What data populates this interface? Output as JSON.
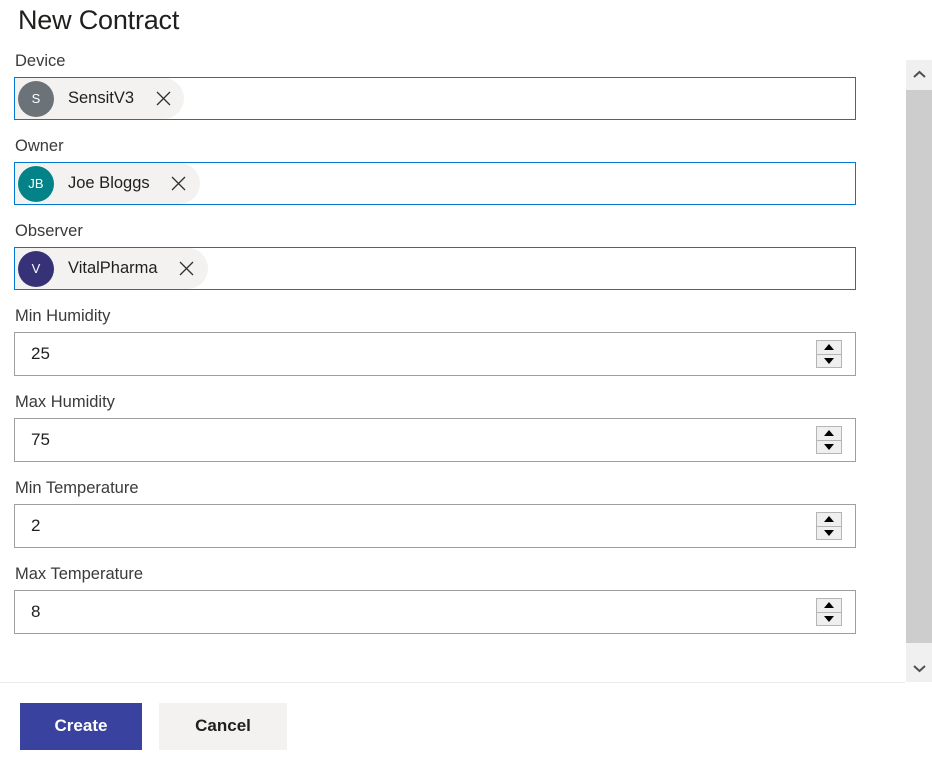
{
  "header": {
    "title": "New Contract"
  },
  "form": {
    "fields": [
      {
        "label": "Device",
        "type": "people-picker",
        "chip": {
          "initials": "S",
          "name": "SensitV3",
          "avatar_color": "#6b7278",
          "remove_icon": "close-icon"
        }
      },
      {
        "label": "Owner",
        "type": "people-picker",
        "chip": {
          "initials": "JB",
          "name": "Joe Bloggs",
          "avatar_color": "#038387",
          "remove_icon": "close-icon"
        }
      },
      {
        "label": "Observer",
        "type": "people-picker",
        "chip": {
          "initials": "V",
          "name": "VitalPharma",
          "avatar_color": "#373277",
          "remove_icon": "close-icon"
        }
      },
      {
        "label": "Min Humidity",
        "type": "number",
        "value": "25"
      },
      {
        "label": "Max Humidity",
        "type": "number",
        "value": "75"
      },
      {
        "label": "Min Temperature",
        "type": "number",
        "value": "2"
      },
      {
        "label": "Max Temperature",
        "type": "number",
        "value": "8"
      }
    ]
  },
  "scrollbar": {
    "up_icon": "chevron-up-icon",
    "down_icon": "chevron-down-icon",
    "thumb": "scrollbar-thumb"
  },
  "footer": {
    "create_label": "Create",
    "cancel_label": "Cancel"
  },
  "colors": {
    "picker_border": "#0078d4",
    "input_border": "#a19f9d",
    "primary_button": "#3a42a0",
    "secondary_button": "#f3f2f1",
    "chip_background": "#f3f2f1",
    "title_text": "#201f1e",
    "label_text": "#3b3a39",
    "scrollbar_track": "#f0f0f0",
    "scrollbar_thumb": "#cdcdcd"
  }
}
